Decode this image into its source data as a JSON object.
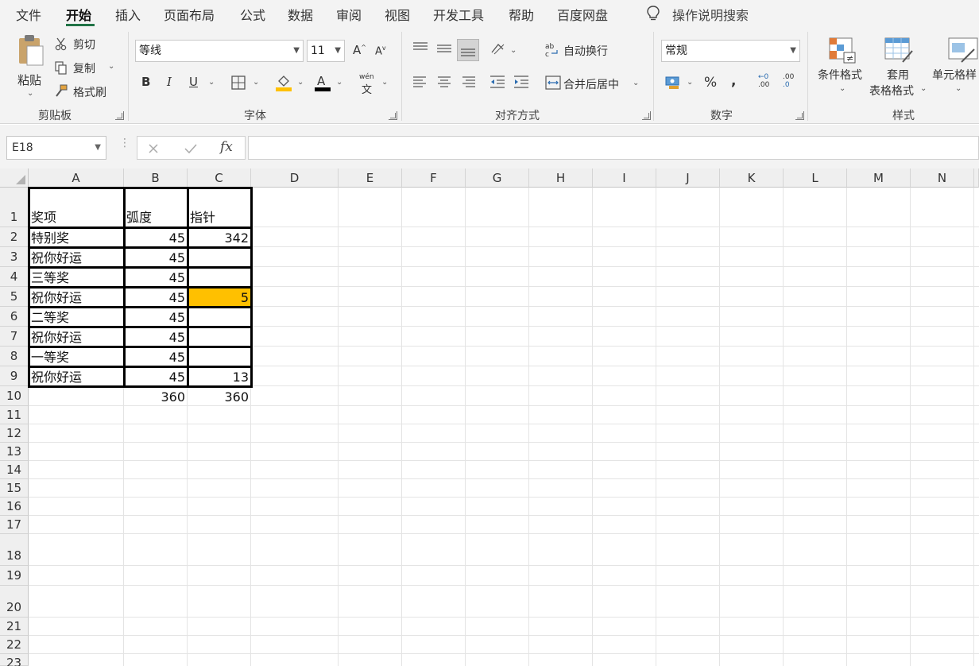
{
  "menu": {
    "tabs": [
      "文件",
      "开始",
      "插入",
      "页面布局",
      "公式",
      "数据",
      "审阅",
      "视图",
      "开发工具",
      "帮助",
      "百度网盘"
    ],
    "active_tab": "开始",
    "tell_me": "操作说明搜索"
  },
  "ribbon": {
    "clipboard": {
      "paste": "粘贴",
      "cut": "剪切",
      "copy": "复制",
      "format_painter": "格式刷",
      "label": "剪贴板"
    },
    "font": {
      "name": "等线",
      "size": "11",
      "bold": "B",
      "italic": "I",
      "underline": "U",
      "phonetic": "wén",
      "label": "字体"
    },
    "alignment": {
      "wrap_text": "自动换行",
      "merge_center": "合并后居中",
      "label": "对齐方式"
    },
    "number": {
      "format": "常规",
      "percent": "%",
      "comma": ",",
      "inc_decimal": ".00",
      "dec_decimal": ".0",
      "label": "数字"
    },
    "styles": {
      "conditional": "条件格式",
      "table_format_1": "套用",
      "table_format_2": "表格格式",
      "cell_styles": "单元格样",
      "label": "样式"
    }
  },
  "formula_bar": {
    "name_box": "E18",
    "fx": "fx",
    "value": ""
  },
  "grid": {
    "columns": [
      "A",
      "B",
      "C",
      "D",
      "E",
      "F",
      "G",
      "H",
      "I",
      "J",
      "K",
      "L",
      "M",
      "N"
    ],
    "rows": [
      "1",
      "2",
      "3",
      "4",
      "5",
      "6",
      "7",
      "8",
      "9",
      "10",
      "11",
      "12",
      "13",
      "14",
      "15",
      "16",
      "17",
      "18",
      "19",
      "20",
      "21",
      "22",
      "23"
    ],
    "cells": {
      "A1": "奖项",
      "B1": "弧度",
      "C1": "指针",
      "A2": "特别奖",
      "B2": "45",
      "C2": "342",
      "A3": "祝你好运",
      "B3": "45",
      "A4": "三等奖",
      "B4": "45",
      "A5": "祝你好运",
      "B5": "45",
      "C5": "5",
      "A6": "二等奖",
      "B6": "45",
      "A7": "祝你好运",
      "B7": "45",
      "A8": "一等奖",
      "B8": "45",
      "A9": "祝你好运",
      "B9": "45",
      "C9": "13",
      "B10": "360",
      "C10": "360"
    },
    "highlight_color": "#FFC000"
  },
  "colors": {
    "accent": "#217346",
    "header_bg": "#EFEFEF",
    "ribbon_bg": "#F3F3F3"
  }
}
